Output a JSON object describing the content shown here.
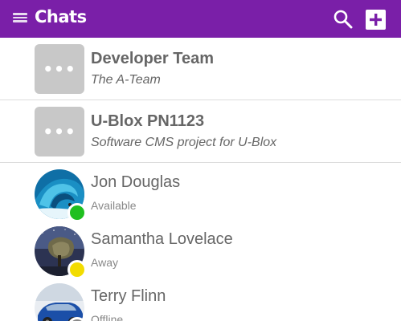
{
  "header": {
    "title": "Chats",
    "bg_color": "#7a1fa8",
    "icons": {
      "menu": "menu-icon",
      "search": "search-icon",
      "add": "add-icon"
    }
  },
  "groups": [
    {
      "avatar_text": "•••",
      "name": "Developer Team",
      "subtitle": "The A-Team"
    },
    {
      "avatar_text": "•••",
      "name": "U-Blox PN1123",
      "subtitle": "Software CMS project for U-Blox"
    }
  ],
  "contacts": [
    {
      "name": "Jon Douglas",
      "status": "Available",
      "status_color": "#1fbf1f"
    },
    {
      "name": "Samantha Lovelace",
      "status": "Away",
      "status_color": "#f2dc00"
    },
    {
      "name": "Terry Flinn",
      "status": "Offline",
      "status_color": "#888888"
    }
  ]
}
